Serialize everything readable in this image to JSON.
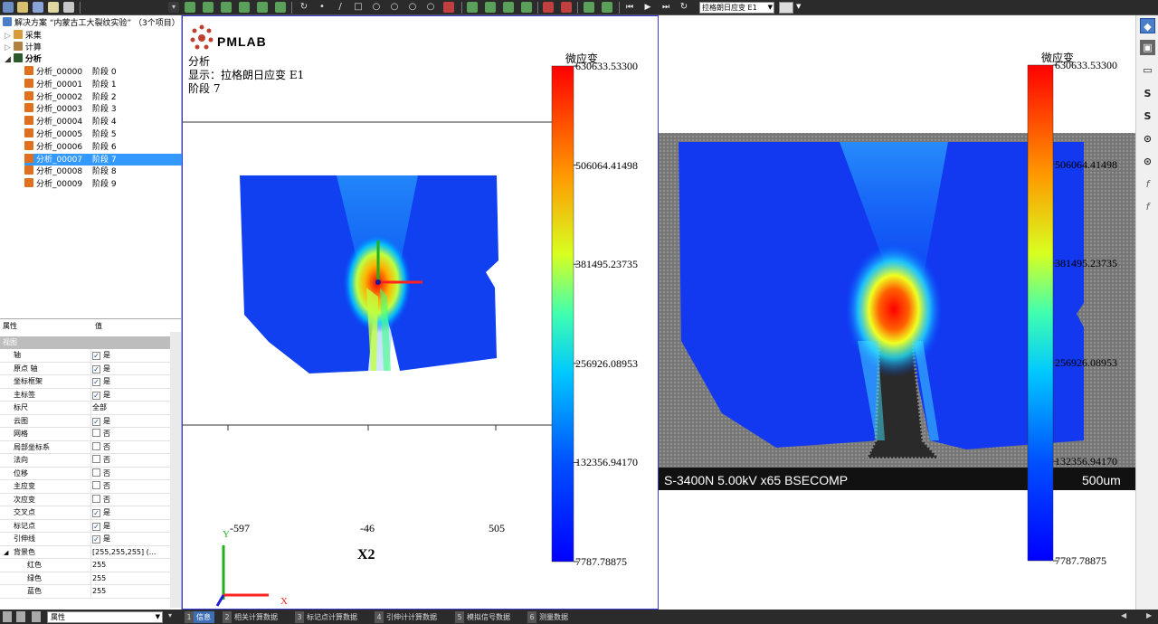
{
  "toolbar": {
    "display_combo": "拉格朗日应变  E1",
    "combo_arrow": "▼"
  },
  "tree": {
    "root": "解决方案 “内蒙古工大裂纹实验” （3个项目）",
    "acquisition": "采集",
    "compute": "计算",
    "analysis": "分析",
    "items": [
      {
        "name": "分析_00000",
        "stage": "阶段 0"
      },
      {
        "name": "分析_00001",
        "stage": "阶段 1"
      },
      {
        "name": "分析_00002",
        "stage": "阶段 2"
      },
      {
        "name": "分析_00003",
        "stage": "阶段 3"
      },
      {
        "name": "分析_00004",
        "stage": "阶段 4"
      },
      {
        "name": "分析_00005",
        "stage": "阶段 5"
      },
      {
        "name": "分析_00006",
        "stage": "阶段 6"
      },
      {
        "name": "分析_00007",
        "stage": "阶段 7"
      },
      {
        "name": "分析_00008",
        "stage": "阶段 8"
      },
      {
        "name": "分析_00009",
        "stage": "阶段 9"
      }
    ],
    "selected_index": 7
  },
  "props": {
    "col_attr": "属性",
    "col_value": "值",
    "group": "视图",
    "rows": [
      {
        "k": "轴",
        "v": "是",
        "checked": true
      },
      {
        "k": "原点 轴",
        "v": "是",
        "checked": true
      },
      {
        "k": "坐标框架",
        "v": "是",
        "checked": true
      },
      {
        "k": "主标签",
        "v": "是",
        "checked": true
      },
      {
        "k": "标尺",
        "v": "全部",
        "checked": null
      },
      {
        "k": "云图",
        "v": "是",
        "checked": true
      },
      {
        "k": "网格",
        "v": "否",
        "checked": false
      },
      {
        "k": "局部坐标系",
        "v": "否",
        "checked": false
      },
      {
        "k": "法向",
        "v": "否",
        "checked": false
      },
      {
        "k": "位移",
        "v": "否",
        "checked": false
      },
      {
        "k": "主应变",
        "v": "否",
        "checked": false
      },
      {
        "k": "次应变",
        "v": "否",
        "checked": false
      },
      {
        "k": "交叉点",
        "v": "是",
        "checked": true
      },
      {
        "k": "标记点",
        "v": "是",
        "checked": true
      },
      {
        "k": "引伸线",
        "v": "是",
        "checked": true
      }
    ],
    "bg_label": "背景色",
    "bg_value": "[255,255,255] (...",
    "red": "红色",
    "red_v": "255",
    "green": "绿色",
    "green_v": "255",
    "blue": "蓝色",
    "blue_v": "255",
    "bottom_combo": "属性"
  },
  "bottom_tabs": [
    {
      "n": "1",
      "label": "信息",
      "active": true
    },
    {
      "n": "2",
      "label": "相关计算数据",
      "active": false
    },
    {
      "n": "3",
      "label": "标记点计算数据",
      "active": false
    },
    {
      "n": "4",
      "label": "引伸计计算数据",
      "active": false
    },
    {
      "n": "5",
      "label": "模拟信号数据",
      "active": false
    },
    {
      "n": "6",
      "label": "测量数据",
      "active": false
    }
  ],
  "view": {
    "logo": "PMLAB",
    "line1": "分析",
    "line2": "显示：拉格朗日应变 E1",
    "line3": "阶段 7",
    "colorbar_title": "微应变",
    "colorbar_ticks": [
      "630633.53300",
      "506064.41498",
      "381495.23735",
      "256926.08953",
      "132356.94170",
      "7787.78875"
    ],
    "axis_ticks": [
      "-597",
      "-46",
      "505"
    ],
    "axis_name": "X2",
    "x_label": "X",
    "y_label": "Y"
  },
  "sem": {
    "caption": "S-3400N 5.00kV x65 BSECOMP",
    "scale": "500um"
  },
  "colors": {
    "selection": "#3399ff",
    "frame": "#3a3ae0"
  }
}
